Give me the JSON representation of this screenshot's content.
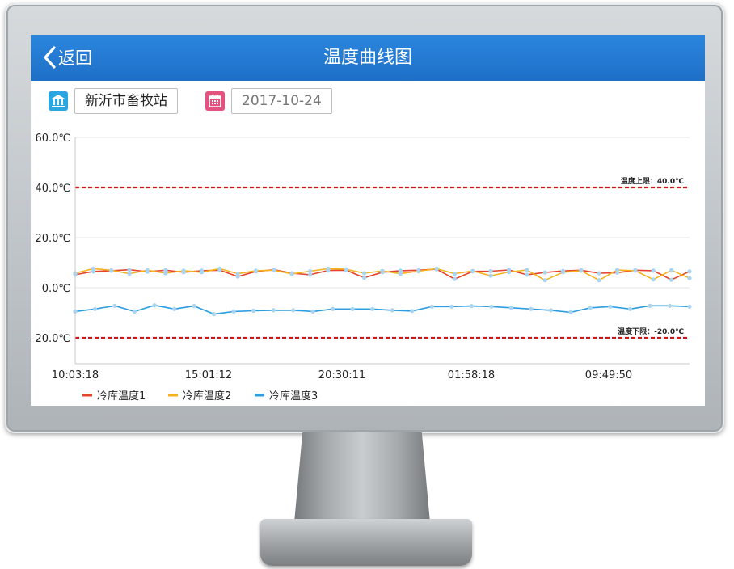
{
  "header": {
    "back_label": "返回",
    "title": "温度曲线图"
  },
  "filters": {
    "station": "新沂市畜牧站",
    "date": "2017-10-24"
  },
  "icons": {
    "back": "chevron-left-icon",
    "station": "building-icon",
    "date": "calendar-icon"
  },
  "colors": {
    "header": "#1f74cc",
    "limit_line": "#d4141b",
    "series1": "#e5432c",
    "series2": "#f5b21c",
    "series3": "#2c9de0",
    "marker": "#a9d4f2"
  },
  "chart_data": {
    "type": "line",
    "title": "",
    "xlabel": "",
    "ylabel": "",
    "ylim": [
      -30,
      60
    ],
    "y_ticks": [
      60,
      40,
      20,
      0,
      -20
    ],
    "y_tick_labels": [
      "60.0℃",
      "40.0℃",
      "20.0℃",
      "0.0℃",
      "-20.0℃"
    ],
    "x_ticks": [
      "10:03:18",
      "15:01:12",
      "20:30:11",
      "01:58:18",
      "09:49:50"
    ],
    "grid": true,
    "legend_position": "bottom-left",
    "upper_limit": {
      "value": 40,
      "label": "温度上限：40.0℃"
    },
    "lower_limit": {
      "value": -20,
      "label": "温度下限：-20.0℃"
    },
    "series": [
      {
        "name": "冷库温度1",
        "values": [
          5.2,
          6.5,
          6.8,
          7.2,
          6.4,
          7.0,
          6.2,
          6.8,
          7.0,
          4.5,
          6.5,
          7.2,
          5.8,
          5.2,
          6.9,
          7.0,
          4.0,
          6.2,
          6.8,
          7.0,
          7.4,
          3.5,
          6.5,
          6.6,
          7.1,
          5.2,
          6.1,
          6.7,
          7.0,
          5.8,
          6.0,
          7.0,
          6.8,
          3.2,
          6.5
        ]
      },
      {
        "name": "冷库温度2",
        "values": [
          5.8,
          7.6,
          7.0,
          5.6,
          7.0,
          5.8,
          6.8,
          6.2,
          7.6,
          5.6,
          6.8,
          7.0,
          5.5,
          6.6,
          7.6,
          7.4,
          5.8,
          6.7,
          5.6,
          6.6,
          7.6,
          5.6,
          6.7,
          4.8,
          6.3,
          7.1,
          3.0,
          6.2,
          6.8,
          3.0,
          7.1,
          6.8,
          3.3,
          7.0,
          3.8
        ]
      },
      {
        "name": "冷库温度3",
        "values": [
          -9.5,
          -8.5,
          -7.2,
          -9.5,
          -7.0,
          -8.5,
          -7.3,
          -10.5,
          -9.5,
          -9.2,
          -9.0,
          -9.0,
          -9.5,
          -8.5,
          -8.5,
          -8.5,
          -9.0,
          -9.3,
          -7.5,
          -7.5,
          -7.3,
          -7.5,
          -8.0,
          -8.5,
          -9.0,
          -9.8,
          -8.0,
          -7.5,
          -8.5,
          -7.2,
          -7.2,
          -7.5
        ]
      }
    ]
  }
}
